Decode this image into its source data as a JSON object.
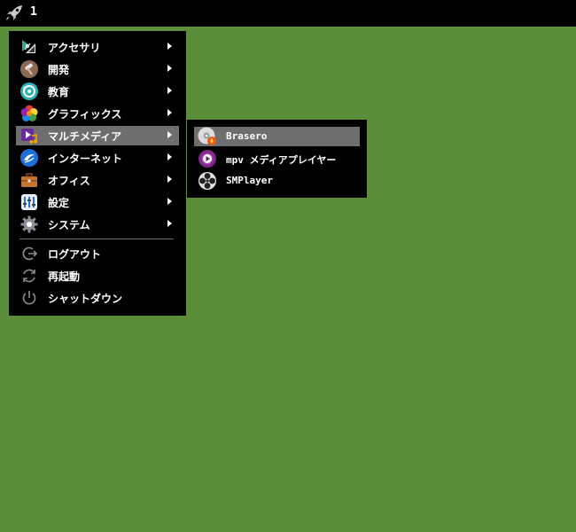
{
  "taskbar": {
    "launcher_icon": "rocket-icon",
    "workspace": "1"
  },
  "menu": {
    "items": [
      {
        "label": "アクセサリ",
        "icon": "accessories-icon"
      },
      {
        "label": "開発",
        "icon": "development-icon"
      },
      {
        "label": "教育",
        "icon": "education-icon"
      },
      {
        "label": "グラフィックス",
        "icon": "graphics-icon"
      },
      {
        "label": "マルチメディア",
        "icon": "multimedia-icon",
        "selected": true
      },
      {
        "label": "インターネット",
        "icon": "internet-icon"
      },
      {
        "label": "オフィス",
        "icon": "office-icon"
      },
      {
        "label": "設定",
        "icon": "settings-icon"
      },
      {
        "label": "システム",
        "icon": "system-icon"
      }
    ],
    "actions": [
      {
        "label": "ログアウト",
        "icon": "logout-icon"
      },
      {
        "label": "再起動",
        "icon": "reboot-icon"
      },
      {
        "label": "シャットダウン",
        "icon": "power-icon"
      }
    ]
  },
  "submenu": {
    "items": [
      {
        "label": "Brasero",
        "icon": "brasero-icon",
        "selected": true
      },
      {
        "label": "mpv メディアプレイヤー",
        "icon": "mpv-icon"
      },
      {
        "label": "SMPlayer",
        "icon": "smplayer-icon"
      }
    ]
  },
  "colors": {
    "desktop": "#5b8e3b",
    "menu_bg": "#000000",
    "selection": "#6e6e6e",
    "text": "#ffffff"
  }
}
